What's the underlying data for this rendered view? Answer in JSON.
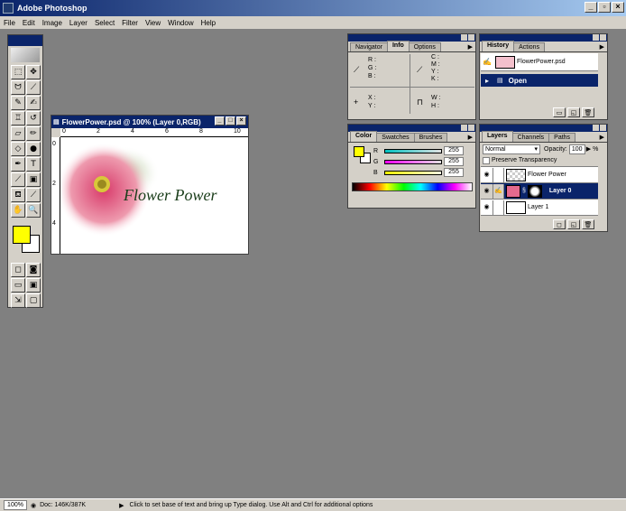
{
  "app": {
    "title": "Adobe Photoshop"
  },
  "menu": [
    "File",
    "Edit",
    "Image",
    "Layer",
    "Select",
    "Filter",
    "View",
    "Window",
    "Help"
  ],
  "document": {
    "title": "FlowerPower.psd @ 100% (Layer 0,RGB)",
    "text": "Flower Power",
    "ruler_top": [
      "0",
      "2",
      "4",
      "6",
      "8",
      "10"
    ],
    "ruler_left": [
      "0",
      "2",
      "4"
    ]
  },
  "info_panel": {
    "tabs": [
      "Navigator",
      "Info",
      "Options"
    ],
    "active_tab": "Info",
    "labels1": [
      "R :",
      "G :",
      "B :"
    ],
    "labels2": [
      "C :",
      "M :",
      "Y :",
      "K :"
    ],
    "labels3": [
      "X :",
      "Y :"
    ],
    "labels4": [
      "W :",
      "H :"
    ]
  },
  "history_panel": {
    "tabs": [
      "History",
      "Actions"
    ],
    "active_tab": "History",
    "snapshot": "FlowerPower.psd",
    "step": "Open"
  },
  "color_panel": {
    "tabs": [
      "Color",
      "Swatches",
      "Brushes"
    ],
    "active_tab": "Color",
    "channels": [
      {
        "label": "R",
        "value": "255",
        "color": "#00a0a0"
      },
      {
        "label": "G",
        "value": "255",
        "color": "#c000c0"
      },
      {
        "label": "B",
        "value": "255",
        "color": "#ffff00"
      }
    ],
    "foreground": "#ffff00",
    "background": "#ffffff"
  },
  "layers_panel": {
    "tabs": [
      "Layers",
      "Channels",
      "Paths"
    ],
    "active_tab": "Layers",
    "blend_mode": "Normal",
    "opacity_label": "Opacity:",
    "opacity": "100",
    "opacity_unit": "%",
    "preserve_transparency": "Preserve Transparency",
    "layers": [
      {
        "name": "Flower Power",
        "selected": false
      },
      {
        "name": "Layer 0",
        "selected": true
      },
      {
        "name": "Layer 1",
        "selected": false
      }
    ]
  },
  "status": {
    "zoom": "100%",
    "doc": "Doc: 146K/387K",
    "hint": "Click to set base of text and bring up Type dialog.  Use Alt and Ctrl for additional options"
  },
  "colors": {
    "title_active": "#0a246a",
    "desktop": "#808080",
    "face": "#d4d0c8"
  }
}
